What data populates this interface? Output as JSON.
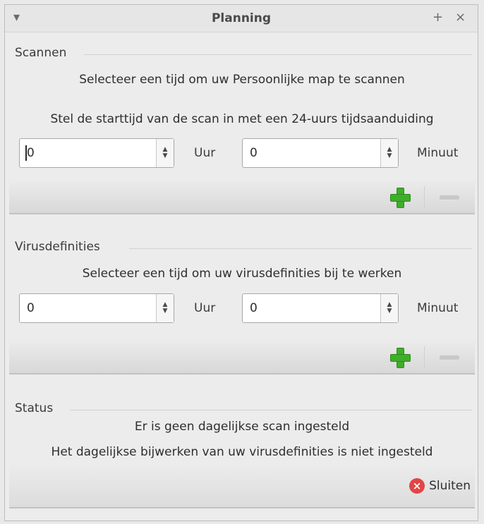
{
  "window": {
    "title": "Planning",
    "menu_icon": "▾",
    "pin_icon": "+",
    "close_icon": "×"
  },
  "scan": {
    "section_label": "Scannen",
    "instruction": "Selecteer een tijd om uw Persoonlijke map te scannen",
    "hint": "Stel de starttijd van de scan in met een 24-uurs tijdsaanduiding",
    "hour_value": "0",
    "hour_unit": "Uur",
    "minute_value": "0",
    "minute_unit": "Minuut"
  },
  "defs": {
    "section_label": "Virusdefinities",
    "instruction": "Selecteer een tijd om uw virusdefinities bij te werken",
    "hour_value": "0",
    "hour_unit": "Uur",
    "minute_value": "0",
    "minute_unit": "Minuut"
  },
  "status": {
    "section_label": "Status",
    "line1": "Er is geen dagelijkse scan ingesteld",
    "line2": "Het dagelijkse bijwerken van uw virusdefinities is niet ingesteld"
  },
  "footer": {
    "close_label": "Sluiten",
    "close_icon": "×"
  },
  "colors": {
    "add": "#3fae2a",
    "close": "#e24545"
  }
}
